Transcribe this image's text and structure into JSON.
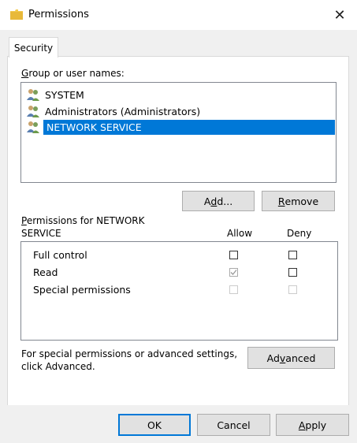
{
  "window": {
    "title": "Permissions",
    "close_glyph": "✕"
  },
  "tabs": [
    {
      "label": "Security"
    }
  ],
  "group_section": {
    "label_prefix": "G",
    "label_rest": "roup or user names:",
    "users": [
      {
        "name": "SYSTEM",
        "icon": "users-icon"
      },
      {
        "name": "Administrators (Administrators)",
        "icon": "users-icon"
      },
      {
        "name": "NETWORK SERVICE",
        "icon": "users-icon",
        "selected": true
      }
    ],
    "add_prefix": "A",
    "add_u": "d",
    "add_rest": "d...",
    "remove_prefix": "",
    "remove_u": "R",
    "remove_rest": "emove"
  },
  "permissions_section": {
    "label_line1_u": "P",
    "label_line1_rest": "ermissions for NETWORK",
    "label_line2": "SERVICE",
    "col_allow": "Allow",
    "col_deny": "Deny",
    "rows": [
      {
        "name": "Full control",
        "allow": "unchecked",
        "deny": "unchecked"
      },
      {
        "name": "Read",
        "allow": "checked-disabled",
        "deny": "unchecked"
      },
      {
        "name": "Special permissions",
        "allow": "disabled",
        "deny": "disabled"
      }
    ]
  },
  "advanced_section": {
    "text_line1": "For special permissions or advanced settings,",
    "text_line2": "click Advanced.",
    "adv_pre": "Ad",
    "adv_u": "v",
    "adv_post": "anced"
  },
  "footer": {
    "ok": "OK",
    "cancel": "Cancel",
    "apply_u": "A",
    "apply_rest": "pply"
  }
}
